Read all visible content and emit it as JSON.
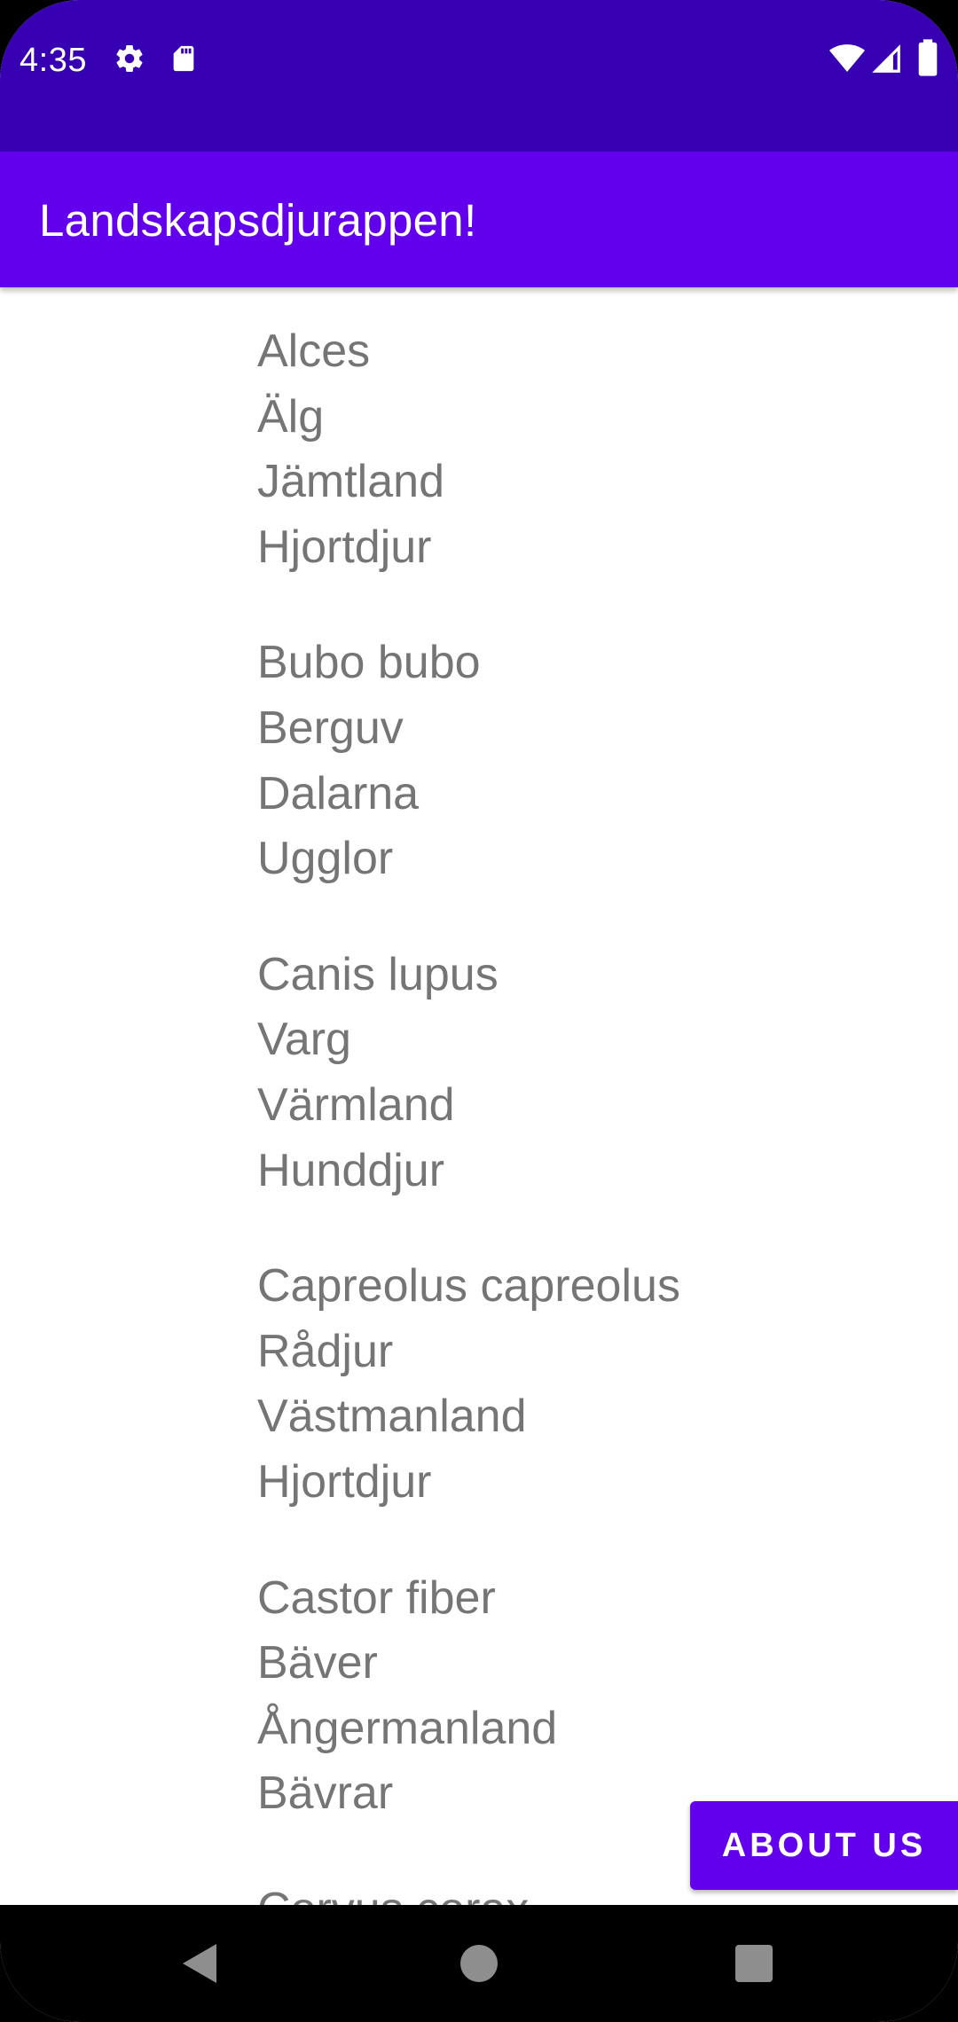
{
  "status_bar": {
    "time": "4:35",
    "background_color": "#3700B3",
    "left_icons": [
      "gear-icon",
      "sd-card-icon"
    ],
    "right_icons": [
      "wifi-icon",
      "cell-signal-icon",
      "battery-icon"
    ]
  },
  "app_bar": {
    "title": "Landskapsdjurappen!",
    "background_color": "#6200EE"
  },
  "animals": [
    {
      "latin": "Alces",
      "name": "Älg",
      "province": "Jämtland",
      "family": "Hjortdjur"
    },
    {
      "latin": "Bubo bubo",
      "name": "Berguv",
      "province": "Dalarna",
      "family": "Ugglor"
    },
    {
      "latin": "Canis lupus",
      "name": "Varg",
      "province": "Värmland",
      "family": "Hunddjur"
    },
    {
      "latin": "Capreolus capreolus",
      "name": "Rådjur",
      "province": "Västmanland",
      "family": "Hjortdjur"
    },
    {
      "latin": "Castor fiber",
      "name": "Bäver",
      "province": "Ångermanland",
      "family": "Bävrar"
    },
    {
      "latin": "Corvus corax",
      "name": "",
      "province": "",
      "family": ""
    }
  ],
  "about_button": {
    "label": "ABOUT US",
    "background_color": "#6200EE"
  },
  "nav_bar": {
    "icons": [
      "back-icon",
      "home-icon",
      "recents-icon"
    ]
  }
}
